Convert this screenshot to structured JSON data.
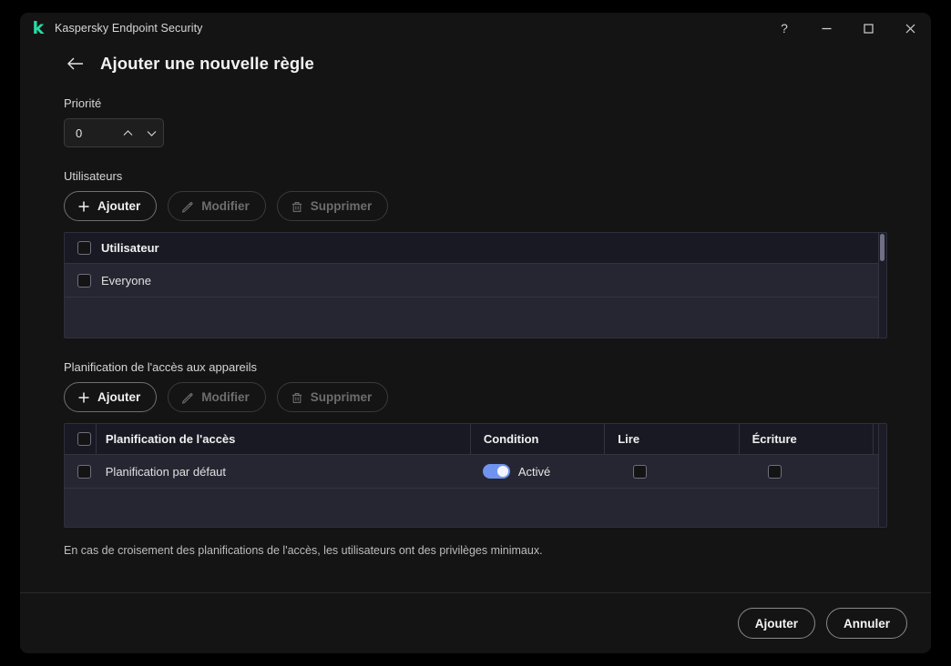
{
  "window": {
    "app_title": "Kaspersky Endpoint Security",
    "logo_letter": "k",
    "logo_color": "#2ad9a5",
    "controls": {
      "help": "help-icon",
      "minimize": "minimize-icon",
      "maximize": "maximize-icon",
      "close": "close-icon"
    }
  },
  "page": {
    "back_label": "back-arrow-icon",
    "title": "Ajouter une nouvelle règle"
  },
  "priority": {
    "label": "Priorité",
    "value": "0",
    "increment_icon": "chevron-up-icon",
    "decrement_icon": "chevron-down-icon"
  },
  "users_section": {
    "label": "Utilisateurs",
    "toolbar": {
      "add": "Ajouter",
      "edit": "Modifier",
      "delete": "Supprimer",
      "add_icon": "plus-icon",
      "edit_icon": "pencil-icon",
      "delete_icon": "trash-icon",
      "edit_disabled": true,
      "delete_disabled": true
    },
    "table": {
      "columns": [
        "Utilisateur"
      ],
      "rows": [
        {
          "name": "Everyone",
          "checked": false
        }
      ],
      "header_checkbox": false
    }
  },
  "schedule_section": {
    "label": "Planification de l'accès aux appareils",
    "toolbar": {
      "add": "Ajouter",
      "edit": "Modifier",
      "delete": "Supprimer",
      "add_icon": "plus-icon",
      "edit_icon": "pencil-icon",
      "delete_icon": "trash-icon",
      "edit_disabled": true,
      "delete_disabled": true
    },
    "table": {
      "columns": [
        "Planification de l'accès",
        "Condition",
        "Lire",
        "Écriture"
      ],
      "rows": [
        {
          "name": "Planification par défaut",
          "checked": false,
          "condition_enabled": true,
          "condition_label": "Activé",
          "read": false,
          "write": false
        }
      ],
      "header_checkbox": false
    }
  },
  "hint": "En cas de croisement des planifications de l'accès, les utilisateurs ont des privilèges minimaux.",
  "footer": {
    "confirm": "Ajouter",
    "cancel": "Annuler"
  },
  "colors": {
    "accent_toggle": "#6f93ef",
    "brand_green": "#2ad9a5",
    "table_row_bg": "#262633",
    "table_header_bg": "#191923"
  }
}
